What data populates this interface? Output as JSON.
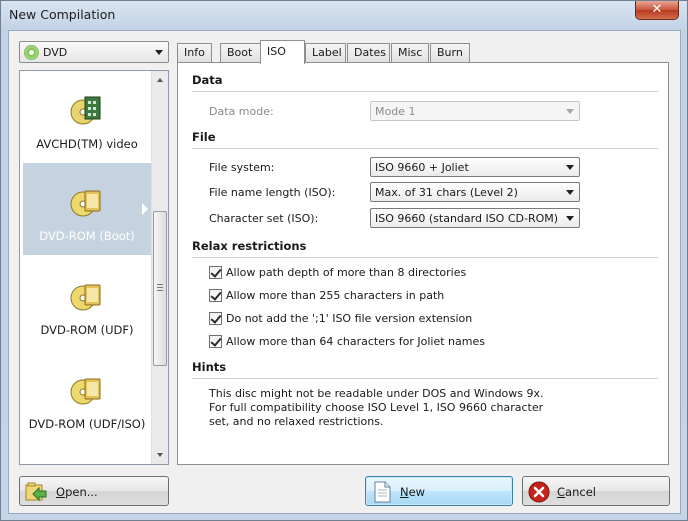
{
  "window": {
    "title": "New Compilation",
    "close_symbol": "✕"
  },
  "media_select": {
    "value": "DVD"
  },
  "media_list": {
    "items": [
      {
        "label": "AVCHD(TM) video",
        "selected": false
      },
      {
        "label": "DVD-ROM (Boot)",
        "selected": true
      },
      {
        "label": "DVD-ROM (UDF)",
        "selected": false
      },
      {
        "label": "DVD-ROM (UDF/ISO)",
        "selected": false
      }
    ]
  },
  "tabs": [
    {
      "label": "Info",
      "active": false
    },
    {
      "label": "Boot",
      "active": false
    },
    {
      "label": "ISO",
      "active": true
    },
    {
      "label": "Label",
      "active": false
    },
    {
      "label": "Dates",
      "active": false
    },
    {
      "label": "Misc",
      "active": false
    },
    {
      "label": "Burn",
      "active": false
    }
  ],
  "iso": {
    "data_heading": "Data",
    "data_mode_label": "Data mode:",
    "data_mode_value": "Mode 1",
    "file_heading": "File",
    "file_system_label": "File system:",
    "file_system_value": "ISO 9660 + Joliet",
    "file_name_length_label": "File name length (ISO):",
    "file_name_length_value": "Max. of 31 chars (Level 2)",
    "character_set_label": "Character set (ISO):",
    "character_set_value": "ISO 9660 (standard ISO CD-ROM)",
    "relax_heading": "Relax restrictions",
    "relax_options": [
      {
        "label": "Allow path depth of more than 8 directories",
        "checked": true
      },
      {
        "label": "Allow more than 255 characters in path",
        "checked": true
      },
      {
        "label": "Do not add the ';1' ISO file version extension",
        "checked": true
      },
      {
        "label": "Allow more than 64 characters for Joliet names",
        "checked": true
      }
    ],
    "hints_heading": "Hints",
    "hints_text": "This disc might not be readable under DOS and Windows 9x. For full compatibility choose ISO Level 1, ISO 9660 character set, and no relaxed restrictions."
  },
  "buttons": {
    "open_first": "O",
    "open_rest": "pen...",
    "new_first": "N",
    "new_rest": "ew",
    "cancel_first": "C",
    "cancel_rest": "ancel"
  },
  "colors": {
    "selection": "#c5d3e1",
    "accent_focus": "#3c7fb1",
    "cancel_red": "#c8231b"
  }
}
